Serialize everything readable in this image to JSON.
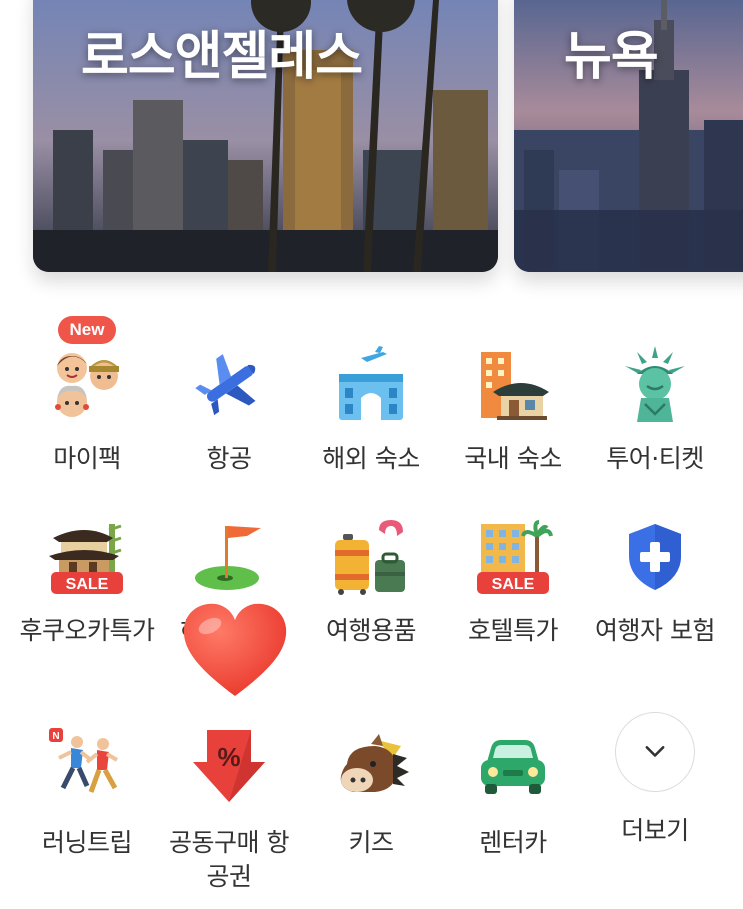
{
  "destinations": [
    {
      "title": "로스앤젤레스"
    },
    {
      "title": "뉴욕"
    }
  ],
  "badge_new": "New",
  "sale_tag": "SALE",
  "categories": [
    {
      "label": "마이팩",
      "icon": "family-faces-icon"
    },
    {
      "label": "항공",
      "icon": "airplane-icon"
    },
    {
      "label": "해외 숙소",
      "icon": "overseas-hotel-icon"
    },
    {
      "label": "국내 숙소",
      "icon": "hanok-house-icon"
    },
    {
      "label": "투어·티켓",
      "icon": "statue-of-liberty-icon"
    },
    {
      "label": "후쿠오카특가",
      "icon": "japanese-inn-sale-icon"
    },
    {
      "label": "해외 골프",
      "icon": "golf-flag-icon"
    },
    {
      "label": "여행용품",
      "icon": "luggage-icon"
    },
    {
      "label": "호텔특가",
      "icon": "hotel-sale-icon"
    },
    {
      "label": "여행자 보험",
      "icon": "shield-plus-icon"
    },
    {
      "label": "러닝트립",
      "icon": "runners-icon"
    },
    {
      "label": "공동구매 항공권",
      "icon": "percent-arrow-icon"
    },
    {
      "label": "키즈",
      "icon": "horse-icon"
    },
    {
      "label": "렌터카",
      "icon": "car-icon"
    },
    {
      "label": "더보기",
      "icon": "chevron-down-icon"
    }
  ],
  "colors": {
    "badge": "#ef5548",
    "airplane": "#3b6fe0",
    "shield": "#3a6fe6",
    "car": "#2ea86a",
    "arrow": "#e8413c",
    "heart": "#f04b3a"
  }
}
